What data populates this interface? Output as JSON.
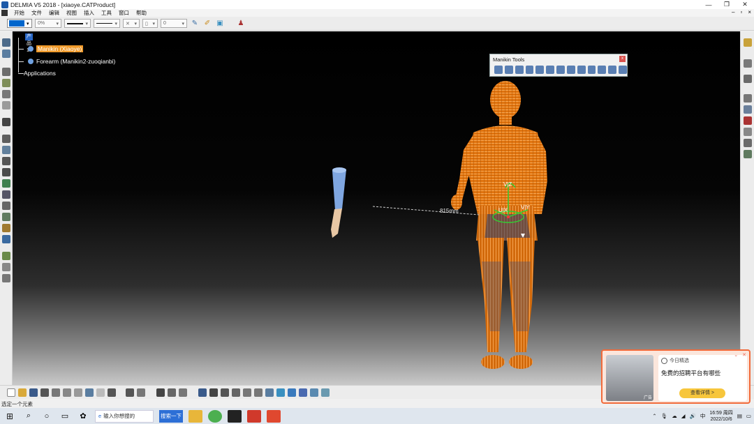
{
  "window": {
    "title": "DELMIA V5 2018 - [xiaoye.CATProduct]",
    "controls": [
      "—",
      "❐",
      "✕"
    ]
  },
  "menu": {
    "items": [
      "开始",
      "文件",
      "编辑",
      "视图",
      "插入",
      "工具",
      "窗口",
      "帮助"
    ]
  },
  "toolbar": {
    "color": "#0066cc",
    "transparency": "0%",
    "layer_value": "0"
  },
  "tree": {
    "root": "产品1",
    "nodes": [
      {
        "label": "Manikin (Xiaoye)"
      },
      {
        "label": "Forearm (Manikin2-zuoqianbi)"
      },
      {
        "label": "Applications"
      }
    ]
  },
  "manikin_tools": {
    "title": "Manikin Tools",
    "close": "x"
  },
  "viewport": {
    "measurement": "815mm",
    "axis_z": "V|Z",
    "axis_x": "U|X",
    "axis_y": "V|Y"
  },
  "status": {
    "text": "选定一个元素"
  },
  "taskbar": {
    "search_placeholder": "输入你想搜的",
    "search_button": "搜索一下",
    "tray_lang": "中",
    "time": "16:59 周四",
    "date": "2022/10/6"
  },
  "ad": {
    "brand": "今日精选",
    "headline": "免费的招聘平台有哪些",
    "cta": "查看详情 >",
    "tag": "广告"
  }
}
